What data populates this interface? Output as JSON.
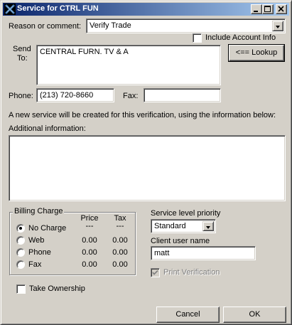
{
  "window": {
    "title": "Service for CTRL FUN",
    "buttons": {
      "minimize": "_",
      "maximize": "□",
      "close": "×"
    }
  },
  "reason": {
    "label": "Reason or comment:",
    "selected": "Verify Trade"
  },
  "include_account_info": {
    "label": "Include Account Info",
    "checked": false
  },
  "send_to": {
    "label_line1": "Send",
    "label_line2": "To:",
    "value": "CENTRAL FURN. TV & A",
    "lookup_label": "<== Lookup"
  },
  "phone": {
    "label": "Phone:",
    "value": "(213) 720-8660"
  },
  "fax": {
    "label": "Fax:",
    "value": ""
  },
  "info_notice": "A new service will be created for this verification, using the information below:",
  "additional_info": {
    "label": "Additional information:",
    "value": ""
  },
  "billing": {
    "title": "Billing Charge",
    "col_price": "Price",
    "col_tax": "Tax",
    "options": [
      {
        "label": "No Charge",
        "price": "---",
        "tax": "---",
        "checked": true
      },
      {
        "label": "Web",
        "price": "0.00",
        "tax": "0.00",
        "checked": false
      },
      {
        "label": "Phone",
        "price": "0.00",
        "tax": "0.00",
        "checked": false
      },
      {
        "label": "Fax",
        "price": "0.00",
        "tax": "0.00",
        "checked": false
      }
    ]
  },
  "service_priority": {
    "label": "Service level priority",
    "selected": "Standard"
  },
  "client_user": {
    "label": "Client user name",
    "value": "matt"
  },
  "print_verification": {
    "label": "Print Verification",
    "checked": true,
    "enabled": false
  },
  "take_ownership": {
    "label": "Take Ownership",
    "checked": false
  },
  "actions": {
    "cancel": "Cancel",
    "ok": "OK"
  },
  "colors": {
    "title_start": "#0a246a",
    "title_end": "#a6caf0",
    "face": "#d4d0c8"
  }
}
